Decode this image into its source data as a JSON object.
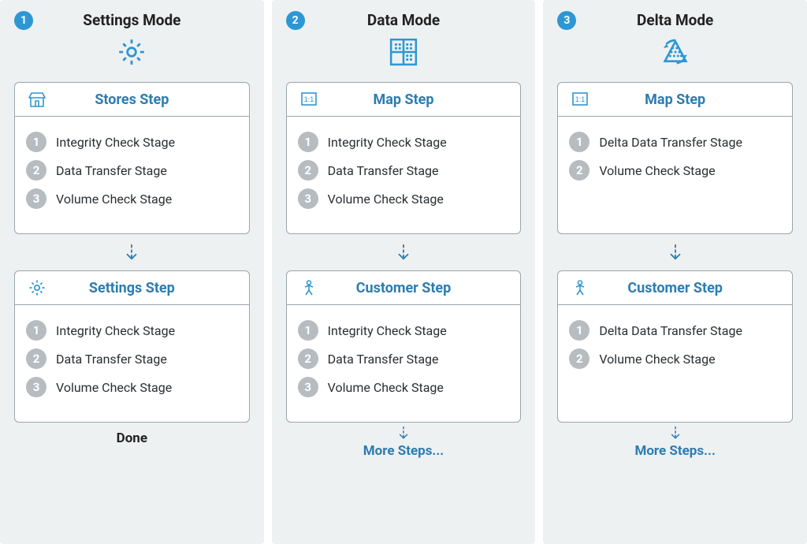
{
  "columns": [
    {
      "badge": "1",
      "title": "Settings Mode",
      "icon": "gear",
      "steps": [
        {
          "icon": "store",
          "title": "Stores Step",
          "stages": [
            {
              "n": "1",
              "label": "Integrity Check Stage"
            },
            {
              "n": "2",
              "label": "Data Transfer Stage"
            },
            {
              "n": "3",
              "label": "Volume Check Stage"
            }
          ]
        },
        {
          "icon": "gear",
          "title": "Settings Step",
          "stages": [
            {
              "n": "1",
              "label": "Integrity Check Stage"
            },
            {
              "n": "2",
              "label": "Data Transfer Stage"
            },
            {
              "n": "3",
              "label": "Volume Check Stage"
            }
          ]
        }
      ],
      "footer": {
        "type": "done",
        "label": "Done"
      }
    },
    {
      "badge": "2",
      "title": "Data Mode",
      "icon": "grid",
      "steps": [
        {
          "icon": "map",
          "title": "Map Step",
          "stages": [
            {
              "n": "1",
              "label": "Integrity Check Stage"
            },
            {
              "n": "2",
              "label": "Data Transfer Stage"
            },
            {
              "n": "3",
              "label": "Volume Check Stage"
            }
          ]
        },
        {
          "icon": "person",
          "title": "Customer Step",
          "stages": [
            {
              "n": "1",
              "label": "Integrity Check Stage"
            },
            {
              "n": "2",
              "label": "Data Transfer Stage"
            },
            {
              "n": "3",
              "label": "Volume Check Stage"
            }
          ]
        }
      ],
      "footer": {
        "type": "more",
        "label": "More Steps..."
      }
    },
    {
      "badge": "3",
      "title": "Delta Mode",
      "icon": "delta",
      "steps": [
        {
          "icon": "map",
          "title": "Map Step",
          "stages": [
            {
              "n": "1",
              "label": "Delta Data Transfer Stage"
            },
            {
              "n": "2",
              "label": "Volume Check Stage"
            }
          ]
        },
        {
          "icon": "person",
          "title": "Customer Step",
          "stages": [
            {
              "n": "1",
              "label": "Delta Data Transfer Stage"
            },
            {
              "n": "2",
              "label": "Volume Check Stage"
            }
          ]
        }
      ],
      "footer": {
        "type": "more",
        "label": "More Steps..."
      }
    }
  ]
}
